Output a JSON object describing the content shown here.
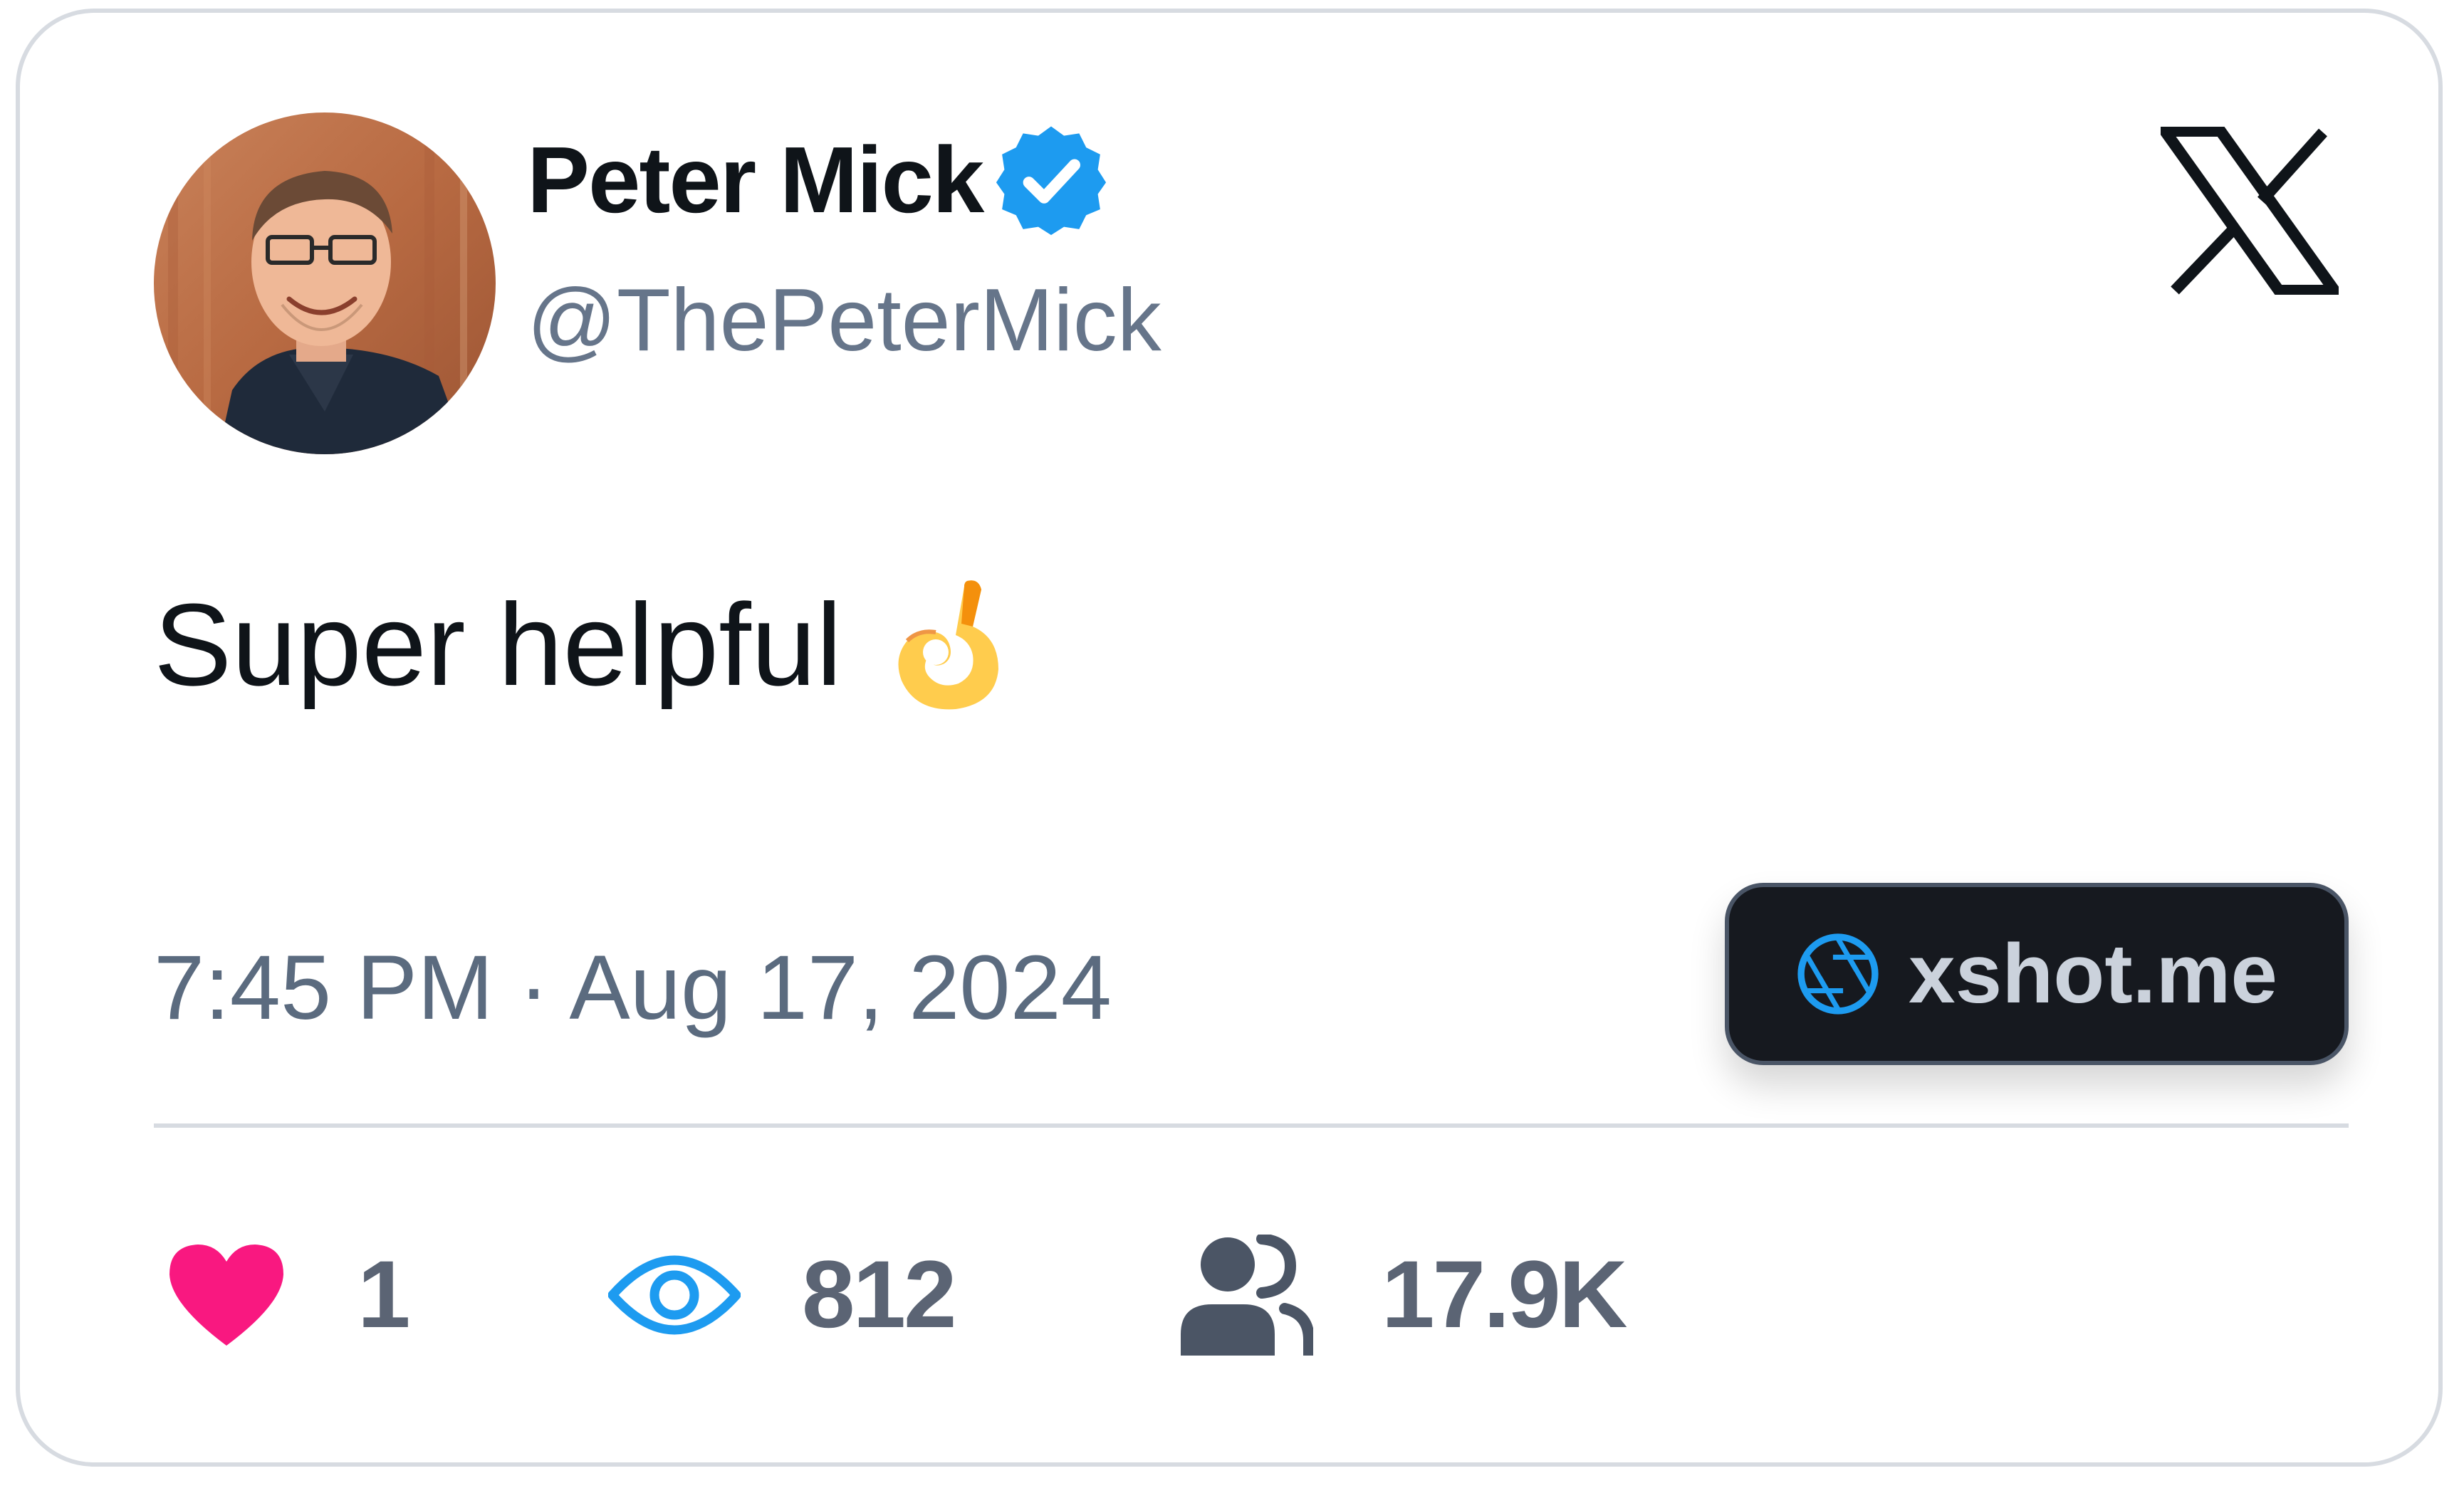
{
  "author": {
    "display_name": "Peter Mick",
    "handle": "@ThePeterMick",
    "verified": true,
    "avatar": "profile-photo"
  },
  "platform_logo": "x-logo",
  "tweet": {
    "text": "Super helpful",
    "emoji": "ok-hand-emoji",
    "timestamp": "7:45 PM · Aug 17, 2024"
  },
  "badge": {
    "icon": "camera-aperture-icon",
    "label": "xshot.me"
  },
  "stats": {
    "likes": {
      "icon": "heart-icon",
      "value": "1"
    },
    "views": {
      "icon": "eye-icon",
      "value": "812"
    },
    "followers": {
      "icon": "users-icon",
      "value": "17.9K"
    }
  },
  "colors": {
    "verified_blue": "#1d9bf0",
    "heart_pink": "#f91880",
    "eye_blue": "#1d9bf0",
    "text_dark": "#0f1419",
    "text_muted": "#5b6b7f",
    "badge_bg": "#16191f"
  }
}
